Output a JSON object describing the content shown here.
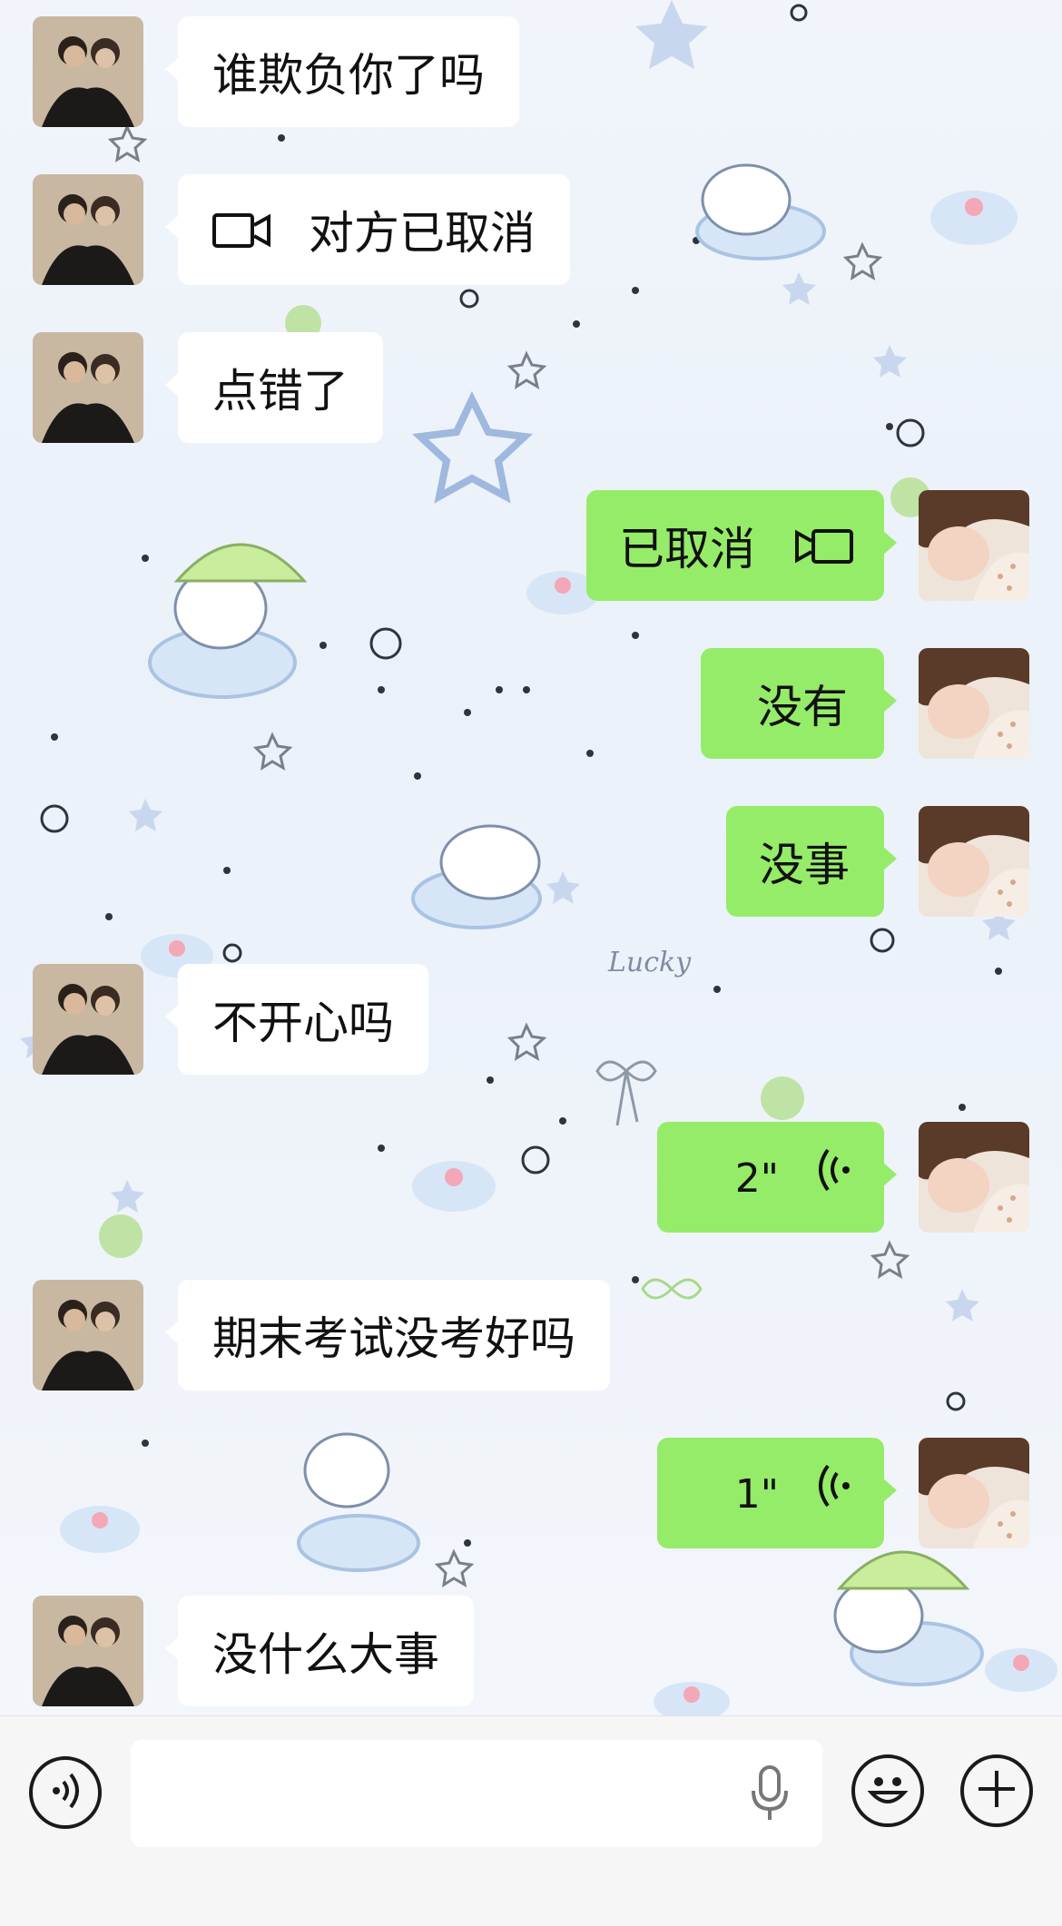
{
  "messages": [
    {
      "side": "in",
      "text": "谁欺负你了吗"
    },
    {
      "side": "in",
      "text": "对方已取消",
      "icon": "video-call-icon"
    },
    {
      "side": "in",
      "text": "点错了"
    },
    {
      "side": "out",
      "text": "已取消",
      "icon": "video-call-icon"
    },
    {
      "side": "out",
      "text": "没有"
    },
    {
      "side": "out",
      "text": "没事"
    },
    {
      "side": "in",
      "text": "不开心吗"
    },
    {
      "side": "out",
      "text": "2\"",
      "icon": "voice-wave-icon"
    },
    {
      "side": "in",
      "text": "期末考试没考好吗"
    },
    {
      "side": "out",
      "text": "1\"",
      "icon": "voice-wave-icon"
    },
    {
      "side": "in",
      "text": "没什么大事"
    }
  ],
  "wallpaper_text": "Lucky",
  "bottom_bar": {
    "voice_toggle_icon": "voice-mode-icon",
    "mic_icon": "microphone-icon",
    "emoji_icon": "emoji-icon",
    "more_icon": "plus-icon"
  },
  "colors": {
    "incoming_bubble": "#ffffff",
    "outgoing_bubble": "#95ec69",
    "wallpaper": "#eef3fa"
  }
}
